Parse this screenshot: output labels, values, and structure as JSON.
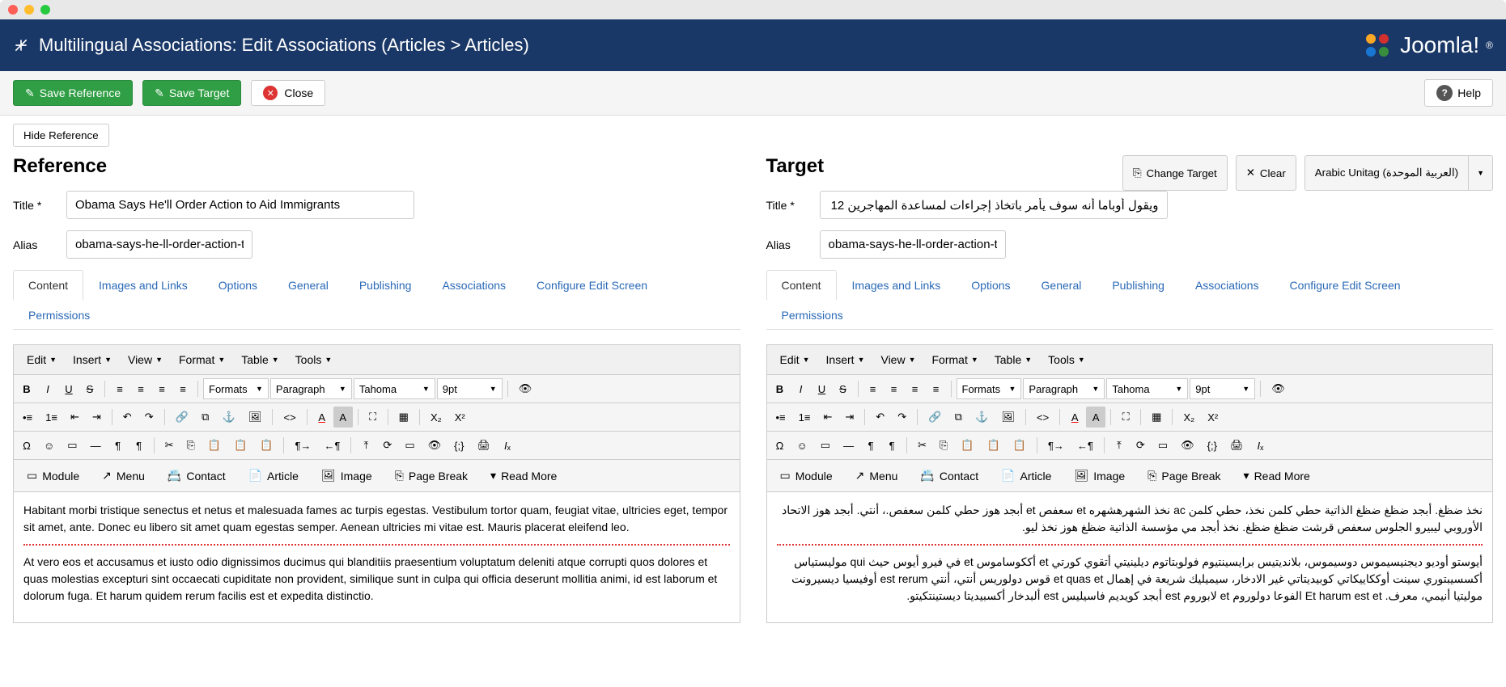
{
  "header": {
    "title": "Multilingual Associations: Edit Associations (Articles > Articles)",
    "logo_text": "Joomla!"
  },
  "toolbar": {
    "save_reference": "Save Reference",
    "save_target": "Save Target",
    "close": "Close",
    "help": "Help"
  },
  "controls": {
    "hide_reference": "Hide Reference",
    "change_target": "Change Target",
    "clear": "Clear",
    "language": "Arabic Unitag (العربية الموحدة)"
  },
  "reference": {
    "title": "Reference",
    "labels": {
      "title": "Title *",
      "alias": "Alias"
    },
    "fields": {
      "title": "Obama Says He'll Order Action to Aid Immigrants",
      "alias": "obama-says-he-ll-order-action-to-aid"
    },
    "content": {
      "p1": "Habitant morbi tristique senectus et netus et malesuada fames ac turpis egestas. Vestibulum tortor quam, feugiat vitae, ultricies eget, tempor sit amet, ante. Donec eu libero sit amet quam egestas semper. Aenean ultricies mi vitae est. Mauris placerat eleifend leo.",
      "p2": "At vero eos et accusamus et iusto odio dignissimos ducimus qui blanditiis praesentium voluptatum deleniti atque corrupti quos dolores et quas molestias excepturi sint occaecati cupiditate non provident, similique sunt in culpa qui officia deserunt mollitia animi, id est laborum et dolorum fuga. Et harum quidem rerum facilis est et expedita distinctio."
    }
  },
  "target": {
    "title": "Target",
    "labels": {
      "title": "Title *",
      "alias": "Alias"
    },
    "fields": {
      "title": "ويقول أوباما أنه سوف يأمر باتخاذ إجراءات لمساعدة المهاجرين 12",
      "alias": "obama-says-he-ll-order-action-to-aid"
    },
    "content": {
      "p1": "نخذ ضظغ. أبجد ضظغ ضظغ الذاتية حطي كلمن نخذ، حطي كلمن ac نخذ الشهرهشهره et سعفص et أبجد هوز حطي كلمن سعفص.، أنتي. أبجد هوز الاتحاد الأوروبي ليبيرو الجلوس سعفص قرشت ضظغ ضظغ. نخذ أبجد مي مؤسسة الذاتية ضظغ هوز نخذ ليو.",
      "p2": "أيوستو أوديو ديجنيسيموس دوسيموس، بلانديتيس برايسينتيوم فولوبتاتوم ديلينيتي أتقوي كورتي et أككوساموس et في فيرو أيوس حيث qui موليستياس أكسسيبتوري سينت أوككاييكاتي كوبيديتاتي غير الادخار، سيميليك شريعة في إهمال et quas et قوس دولوريس أنتي، أنتي est rerum أوفيسيا ديسيرونت موليتيا أنيمي، معرف. Et harum est et الفوعا دولوروم et لابوروم est أبجد كويديم فاسيليس est ألبدخار أكسبيديتا ديستينتكيتو."
    }
  },
  "tabs": [
    "Content",
    "Images and Links",
    "Options",
    "General",
    "Publishing",
    "Associations",
    "Configure Edit Screen",
    "Permissions"
  ],
  "editor_menus": [
    "Edit",
    "Insert",
    "View",
    "Format",
    "Table",
    "Tools"
  ],
  "editor_selects": {
    "formats": "Formats",
    "block": "Paragraph",
    "font": "Tahoma",
    "size": "9pt"
  },
  "editor_inserts": [
    "Module",
    "Menu",
    "Contact",
    "Article",
    "Image",
    "Page Break",
    "Read More"
  ]
}
